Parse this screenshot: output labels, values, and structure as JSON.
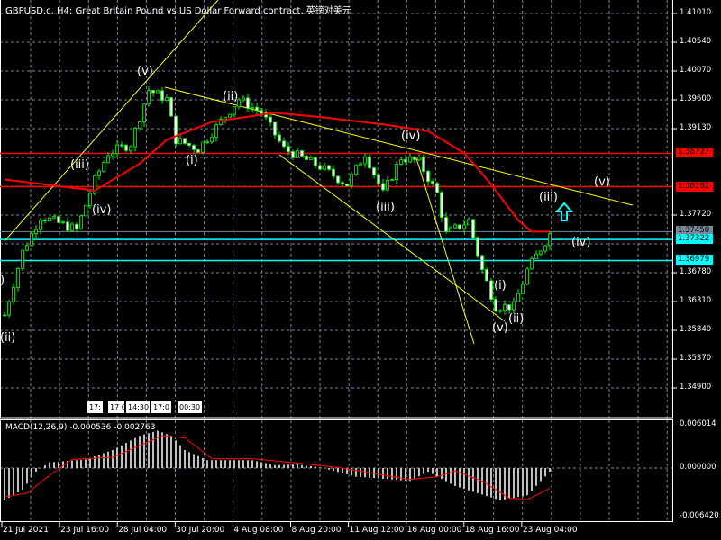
{
  "header": {
    "title": "GBPUSD.c, H4:  Great Britain Pound vs US Dollar Forward contract, 英镑对美元"
  },
  "macd": {
    "title": "MACD(12,26,9) -0.000536 -0.002763",
    "ticks": [
      "0.006014",
      "0.000000",
      "-0.006420"
    ]
  },
  "price_ticks": [
    "1.41010",
    "1.40540",
    "1.40070",
    "1.39600",
    "1.39130",
    "1.37720",
    "1.36780",
    "1.36310",
    "1.35840",
    "1.35370",
    "1.34900"
  ],
  "price_lines": [
    {
      "label": "1.38727",
      "value": 1.38727,
      "color": "#ff0000",
      "text_color": "#000000"
    },
    {
      "label": "1.38182",
      "value": 1.38182,
      "color": "#ff0000",
      "text_color": "#000000"
    },
    {
      "label": "1.37450",
      "value": 1.3745,
      "color": "#778899",
      "text_color": "#000000"
    },
    {
      "label": "1.37322",
      "value": 1.37322,
      "color": "#00ffff",
      "text_color": "#000000"
    },
    {
      "label": "1.36979",
      "value": 1.36979,
      "color": "#00ffff",
      "text_color": "#000000"
    }
  ],
  "time_labels": [
    "21 Jul 2021",
    "23 Jul 16:00",
    "28 Jul 04:00",
    "30 Jul 20:00",
    "4 Aug 08:00",
    "8 Aug 20:00",
    "11 Aug 12:00",
    "16 Aug 00:00",
    "18 Aug 16:00",
    "23 Aug 04:00"
  ],
  "ruler_labels": [
    "17:",
    "17 0",
    "14:30",
    "17:0",
    "00:30"
  ],
  "wave_labels": [
    "(v)",
    "(iii)",
    "(iv)",
    "(i)",
    "(ii)",
    "(iv)",
    "(iii)",
    "(iii)",
    "(v)",
    "(iv)",
    "(i)",
    "(ii)",
    "(v)",
    ")",
    "(ii)"
  ],
  "colors": {
    "bull": "#00ff00",
    "ma": "#ff0000",
    "trend": "#ffff00",
    "grid": "#778899",
    "arrow": "#00ffff"
  },
  "chart_data": {
    "type": "candlestick",
    "symbol": "GBPUSD.c",
    "timeframe": "H4",
    "ylim": [
      1.3443,
      1.4125
    ],
    "price_path": [
      [
        0,
        1.3609
      ],
      [
        4,
        1.3712
      ],
      [
        8,
        1.377
      ],
      [
        16,
        1.3748
      ],
      [
        20,
        1.3829
      ],
      [
        23,
        1.3873
      ],
      [
        28,
        1.3888
      ],
      [
        32,
        1.3976
      ],
      [
        36,
        1.3961
      ],
      [
        38,
        1.3895
      ],
      [
        43,
        1.388
      ],
      [
        48,
        1.3925
      ],
      [
        52,
        1.3961
      ],
      [
        57,
        1.3939
      ],
      [
        62,
        1.388
      ],
      [
        70,
        1.3851
      ],
      [
        76,
        1.3822
      ],
      [
        80,
        1.3873
      ],
      [
        84,
        1.3807
      ],
      [
        88,
        1.3866
      ],
      [
        92,
        1.3859
      ],
      [
        96,
        1.3807
      ],
      [
        98,
        1.3741
      ],
      [
        103,
        1.3763
      ],
      [
        106,
        1.3682
      ],
      [
        109,
        1.3623
      ],
      [
        113,
        1.3623
      ],
      [
        116,
        1.3682
      ],
      [
        121,
        1.3741
      ]
    ],
    "ma_path": [
      [
        0,
        1.383
      ],
      [
        20,
        1.3812
      ],
      [
        30,
        1.3856
      ],
      [
        36,
        1.3895
      ],
      [
        46,
        1.3924
      ],
      [
        60,
        1.3939
      ],
      [
        70,
        1.3932
      ],
      [
        84,
        1.392
      ],
      [
        94,
        1.3909
      ],
      [
        102,
        1.3873
      ],
      [
        108,
        1.3822
      ],
      [
        114,
        1.3763
      ],
      [
        117,
        1.3745
      ],
      [
        121,
        1.3745
      ]
    ],
    "macd_hist_path": [
      [
        0,
        -0.0045
      ],
      [
        4,
        -0.003
      ],
      [
        7,
        -0.0005
      ],
      [
        10,
        0.0008
      ],
      [
        18,
        0.0012
      ],
      [
        24,
        0.0025
      ],
      [
        30,
        0.0045
      ],
      [
        34,
        0.0052
      ],
      [
        37,
        0.0045
      ],
      [
        40,
        0.0025
      ],
      [
        45,
        0.0011
      ],
      [
        55,
        0.0011
      ],
      [
        60,
        0.0004
      ],
      [
        65,
        0.0005
      ],
      [
        70,
        0.0001
      ],
      [
        78,
        -0.0012
      ],
      [
        90,
        -0.0018
      ],
      [
        94,
        -0.0005
      ],
      [
        100,
        -0.0025
      ],
      [
        110,
        -0.0045
      ],
      [
        116,
        -0.0038
      ],
      [
        121,
        -0.0005
      ]
    ],
    "macd_signal_path": [
      [
        0,
        -0.004
      ],
      [
        5,
        -0.0035
      ],
      [
        10,
        -0.001
      ],
      [
        15,
        0.0012
      ],
      [
        24,
        0.0015
      ],
      [
        35,
        0.0045
      ],
      [
        40,
        0.0042
      ],
      [
        46,
        0.0013
      ],
      [
        55,
        0.0013
      ],
      [
        65,
        0.0007
      ],
      [
        75,
        0.0
      ],
      [
        90,
        -0.0016
      ],
      [
        96,
        -0.0012
      ],
      [
        100,
        -0.0004
      ],
      [
        106,
        -0.0018
      ],
      [
        112,
        -0.0042
      ],
      [
        116,
        -0.0044
      ],
      [
        121,
        -0.0028
      ]
    ]
  }
}
